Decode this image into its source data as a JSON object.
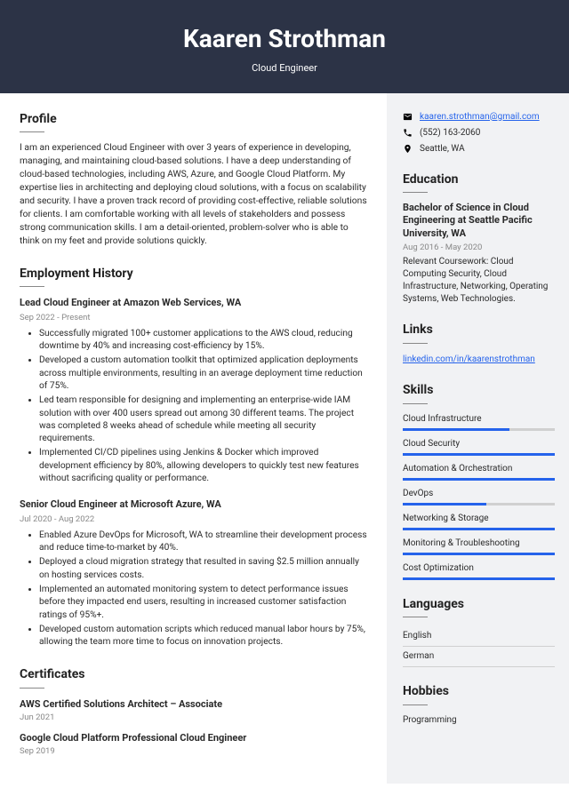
{
  "header": {
    "name": "Kaaren Strothman",
    "title": "Cloud Engineer"
  },
  "profile": {
    "heading": "Profile",
    "text": "I am an experienced Cloud Engineer with over 3 years of experience in developing, managing, and maintaining cloud-based solutions. I have a deep understanding of cloud-based technologies, including AWS, Azure, and Google Cloud Platform. My expertise lies in architecting and deploying cloud solutions, with a focus on scalability and security. I have a proven track record of providing cost-effective, reliable solutions for clients. I am comfortable working with all levels of stakeholders and possess strong communication skills. I am a detail-oriented, problem-solver who is able to think on my feet and provide solutions quickly."
  },
  "employment": {
    "heading": "Employment History",
    "jobs": [
      {
        "title": "Lead Cloud Engineer at Amazon Web Services, WA",
        "dates": "Sep 2022 - Present",
        "bullets": [
          "Successfully migrated 100+ customer applications to the AWS cloud, reducing downtime by 40% and increasing cost-efficiency by 15%.",
          "Developed a custom automation toolkit that optimized application deployments across multiple environments, resulting in an average deployment time reduction of 75%.",
          "Led team responsible for designing and implementing an enterprise-wide IAM solution with over 400 users spread out among 30 different teams. The project was completed 8 weeks ahead of schedule while meeting all security requirements.",
          "Implemented CI/CD pipelines using Jenkins & Docker which improved development efficiency by 80%, allowing developers to quickly test new features without sacrificing quality or performance."
        ]
      },
      {
        "title": "Senior Cloud Engineer at Microsoft Azure, WA",
        "dates": "Jul 2020 - Aug 2022",
        "bullets": [
          "Enabled Azure DevOps for Microsoft, WA to streamline their development process and reduce time-to-market by 40%.",
          "Deployed a cloud migration strategy that resulted in saving $2.5 million annually on hosting services costs.",
          "Implemented an automated monitoring system to detect performance issues before they impacted end users, resulting in increased customer satisfaction ratings of 95%+.",
          "Developed custom automation scripts which reduced manual labor hours by 75%, allowing the team more time to focus on innovation projects."
        ]
      }
    ]
  },
  "certificates": {
    "heading": "Certificates",
    "items": [
      {
        "title": "AWS Certified Solutions Architect – Associate",
        "date": "Jun 2021"
      },
      {
        "title": "Google Cloud Platform Professional Cloud Engineer",
        "date": "Sep 2019"
      }
    ]
  },
  "contact": {
    "email": "kaaren.strothman@gmail.com",
    "phone": "(552) 163-2060",
    "location": "Seattle, WA"
  },
  "education": {
    "heading": "Education",
    "degree": "Bachelor of Science in Cloud Engineering at Seattle Pacific University, WA",
    "dates": "Aug 2016 - May 2020",
    "body": "Relevant Coursework: Cloud Computing Security, Cloud Infrastructure, Networking, Operating Systems, Web Technologies."
  },
  "links": {
    "heading": "Links",
    "url": "linkedin.com/in/kaarenstrothman"
  },
  "skills": {
    "heading": "Skills",
    "items": [
      {
        "name": "Cloud Infrastructure",
        "level": 70
      },
      {
        "name": "Cloud Security",
        "level": 100
      },
      {
        "name": "Automation & Orchestration",
        "level": 100
      },
      {
        "name": "DevOps",
        "level": 55
      },
      {
        "name": "Networking & Storage",
        "level": 100
      },
      {
        "name": "Monitoring & Troubleshooting",
        "level": 100
      },
      {
        "name": "Cost Optimization",
        "level": 100
      }
    ]
  },
  "languages": {
    "heading": "Languages",
    "items": [
      "English",
      "German"
    ]
  },
  "hobbies": {
    "heading": "Hobbies",
    "items": [
      "Programming"
    ]
  }
}
